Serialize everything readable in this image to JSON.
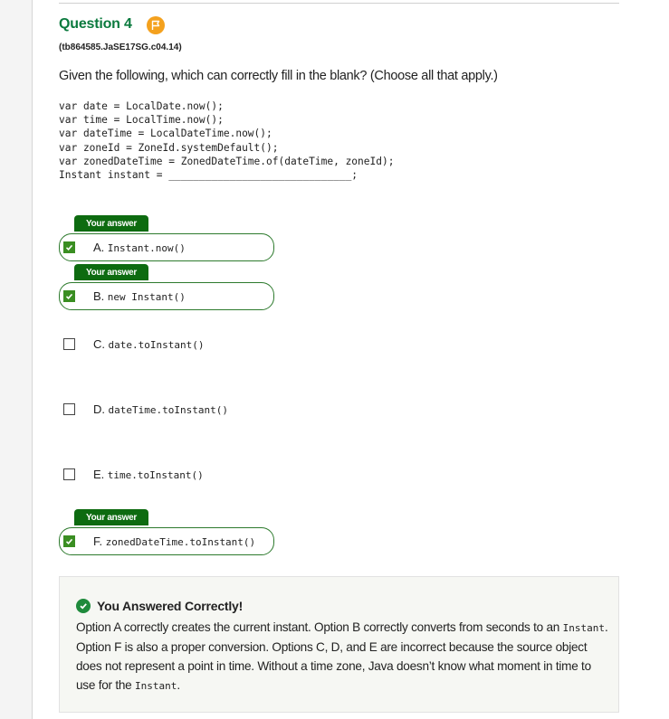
{
  "question": {
    "title": "Question 4",
    "flag_icon": "flag-icon",
    "id": "(tb864585.JaSE17SG.c04.14)",
    "prompt": "Given the following, which can correctly fill in the blank? (Choose all that apply.)",
    "code_lines": [
      "var date = LocalDate.now();",
      "var time = LocalTime.now();",
      "var dateTime = LocalDateTime.now();",
      "var zoneId = ZoneId.systemDefault();",
      "var zonedDateTime = ZonedDateTime.of(dateTime, zoneId);",
      "Instant instant = ______________________________;"
    ]
  },
  "your_answer_label": "Your answer",
  "options": [
    {
      "letter": "A.",
      "code": "Instant.now()",
      "selected": true,
      "your_answer": true
    },
    {
      "letter": "B.",
      "code": "new Instant()",
      "selected": true,
      "your_answer": true
    },
    {
      "letter": "C.",
      "code": "date.toInstant()",
      "selected": false,
      "your_answer": false
    },
    {
      "letter": "D.",
      "code": "dateTime.toInstant()",
      "selected": false,
      "your_answer": false
    },
    {
      "letter": "E.",
      "code": "time.toInstant()",
      "selected": false,
      "your_answer": false
    },
    {
      "letter": "F.",
      "code": "zonedDateTime.toInstant()",
      "selected": true,
      "your_answer": true
    }
  ],
  "feedback": {
    "icon": "check-circle-icon",
    "title": "You Answered Correctly!",
    "text_parts": [
      "Option A correctly creates the current instant. Option B correctly converts from seconds to an ",
      "Instant",
      ". Option F is also a proper conversion. Options C, D, and E are incorrect because the source object does not represent a point in time. Without a time zone, Java doesn’t know what moment in time to use for the ",
      "Instant",
      "."
    ]
  },
  "colors": {
    "title_green": "#0b7a3e",
    "tab_green": "#0d6b10",
    "checkbox_green": "#3a8e22",
    "flag_orange": "#f4a11e",
    "feedback_bg": "#f6f7f3"
  }
}
